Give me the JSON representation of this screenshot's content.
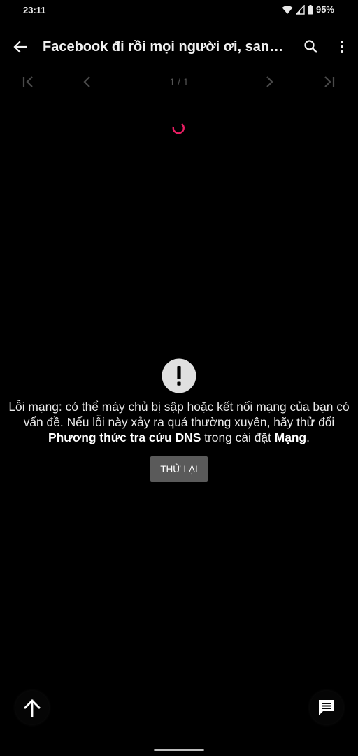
{
  "status": {
    "time": "23:11",
    "battery": "95%"
  },
  "appbar": {
    "title": "Facebook đi rồi mọi người ơi, sang V..."
  },
  "pager": {
    "indicator": "1 / 1"
  },
  "error": {
    "line1": "Lỗi mạng: có thể máy chủ bị sập hoặc kết nối mạng của bạn có vấn đề. Nếu lỗi này xảy ra quá thường xuyên, hãy thử đổi ",
    "bold1": "Phương thức tra cứu DNS",
    "mid": " trong cài đặt ",
    "bold2": "Mạng",
    "end": ".",
    "retry_label": "THỬ LẠI"
  },
  "colors": {
    "accent": "#e91e63",
    "background": "#000000",
    "button": "#5a5a5a"
  },
  "icons": [
    "back-arrow-icon",
    "search-icon",
    "more-vert-icon",
    "first-page-icon",
    "prev-page-icon",
    "next-page-icon",
    "last-page-icon",
    "loading-spinner-icon",
    "alert-icon",
    "arrow-up-icon",
    "comment-icon"
  ]
}
